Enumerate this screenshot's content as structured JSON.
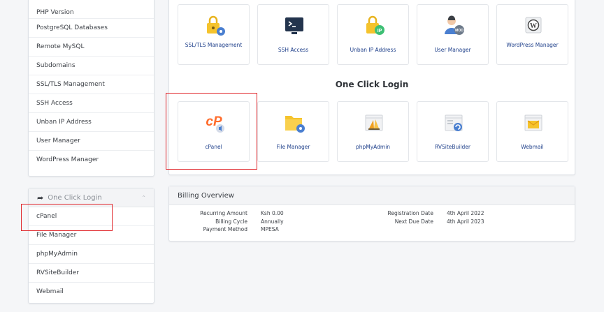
{
  "sidebar_top": {
    "items": [
      {
        "label": "PHP Version"
      },
      {
        "label": "PostgreSQL Databases"
      },
      {
        "label": "Remote MySQL"
      },
      {
        "label": "Subdomains"
      },
      {
        "label": "SSL/TLS Management"
      },
      {
        "label": "SSH Access"
      },
      {
        "label": "Unban IP Address"
      },
      {
        "label": "User Manager"
      },
      {
        "label": "WordPress Manager"
      }
    ]
  },
  "sidebar_bottom": {
    "title": "One Click Login",
    "items": [
      {
        "label": "cPanel"
      },
      {
        "label": "File Manager"
      },
      {
        "label": "phpMyAdmin"
      },
      {
        "label": "RVSiteBuilder"
      },
      {
        "label": "Webmail"
      }
    ]
  },
  "tools": [
    {
      "label": "SSL/TLS Management",
      "icon": "ssl-lock-icon"
    },
    {
      "label": "SSH Access",
      "icon": "terminal-icon"
    },
    {
      "label": "Unban IP Address",
      "icon": "ip-lock-icon"
    },
    {
      "label": "User Manager",
      "icon": "user-manager-icon"
    },
    {
      "label": "WordPress Manager",
      "icon": "wordpress-icon"
    }
  ],
  "one_click": {
    "title": "One Click Login",
    "tiles": [
      {
        "label": "cPanel",
        "icon": "cpanel-icon"
      },
      {
        "label": "File Manager",
        "icon": "folder-icon"
      },
      {
        "label": "phpMyAdmin",
        "icon": "phpmyadmin-icon"
      },
      {
        "label": "RVSiteBuilder",
        "icon": "rvsitebuilder-icon"
      },
      {
        "label": "Webmail",
        "icon": "webmail-icon"
      }
    ]
  },
  "billing": {
    "title": "Billing Overview",
    "left": {
      "keys": [
        "Recurring Amount",
        "Billing Cycle",
        "Payment Method"
      ],
      "values": [
        "Ksh 0.00",
        "Annually",
        "MPESA"
      ]
    },
    "right": {
      "keys": [
        "Registration Date",
        "Next Due Date"
      ],
      "values": [
        "4th April 2022",
        "4th April 2023"
      ]
    }
  },
  "colors": {
    "link": "#1e3f8a",
    "highlight": "#e0262b",
    "cpanel_orange": "#ff6c2c",
    "lock_yellow": "#f5c32c",
    "accent_blue": "#4a7fd0"
  }
}
